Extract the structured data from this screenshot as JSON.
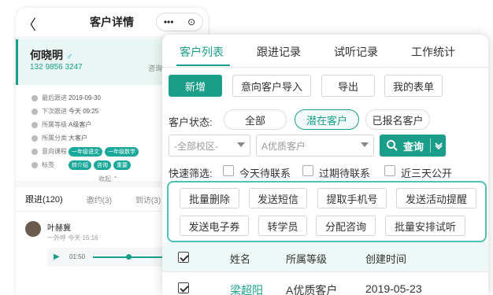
{
  "back_phone": {
    "nav_title": "客户详情",
    "back_glyph": "〈",
    "capsule_more": "•••",
    "capsule_close": "⊙",
    "customer": {
      "name": "何晓明",
      "gender_glyph": "♂",
      "phone": "132 9856 3247",
      "consult": "咨询"
    },
    "detail_rows": [
      {
        "label": "最后跟进",
        "value": "2019-09-30"
      },
      {
        "label": "下次跟进",
        "value": "今天 09:25"
      },
      {
        "label": "所属等级",
        "value": "A级客户"
      },
      {
        "label": "所属分类",
        "value": "大客户"
      },
      {
        "label": "意向课程",
        "tags": [
          "一年级语文",
          "一年级数学"
        ]
      },
      {
        "label": "标签",
        "tags": [
          "转介绍",
          "咨询",
          "重要"
        ]
      }
    ],
    "collapse_label": "收起 ⌃",
    "subtabs": [
      "跟进(120)",
      "邀约(3)",
      "到访(3)"
    ],
    "follow_item": {
      "name": "叶赫冀",
      "meta": "一外呼  今天 16:16",
      "audio_time": "01:50",
      "audio_progress": 0.35
    }
  },
  "panel": {
    "tabs": [
      "客户列表",
      "跟进记录",
      "试听记录",
      "工作统计"
    ],
    "active_tab": 0,
    "toolbar": {
      "add": "新增",
      "import": "意向客户导入",
      "export": "导出",
      "my_form": "我的表单"
    },
    "status": {
      "label": "客户状态:",
      "options": [
        "全部",
        "潜在客户",
        "已报名客户"
      ],
      "active": 1
    },
    "filters": {
      "campus_placeholder": "-全部校区-",
      "level_placeholder": "A优质客户",
      "query": "查询",
      "query_icon": "search-icon",
      "dropdown_icon": "chevron-down-icon"
    },
    "quick_filter": {
      "label": "快速筛选:",
      "options": [
        "今天待联系",
        "过期待联系",
        "近三天公开"
      ]
    },
    "batch_actions": {
      "row1": [
        "批量删除",
        "发送短信",
        "提取手机号",
        "发送活动提醒"
      ],
      "row2": [
        "发送电子券",
        "转学员",
        "分配咨询",
        "批量安排试听"
      ]
    },
    "table": {
      "headers": [
        "姓名",
        "所属等级",
        "创建时间"
      ],
      "rows": [
        {
          "name": "梁超阳",
          "level": "A优质客户",
          "created": "2019-05-23",
          "checked": true
        }
      ]
    }
  },
  "colors": {
    "brand": "#1a9e8a",
    "highlight_border": "#4cc3b4",
    "table_header_bg": "#eef8f6"
  }
}
